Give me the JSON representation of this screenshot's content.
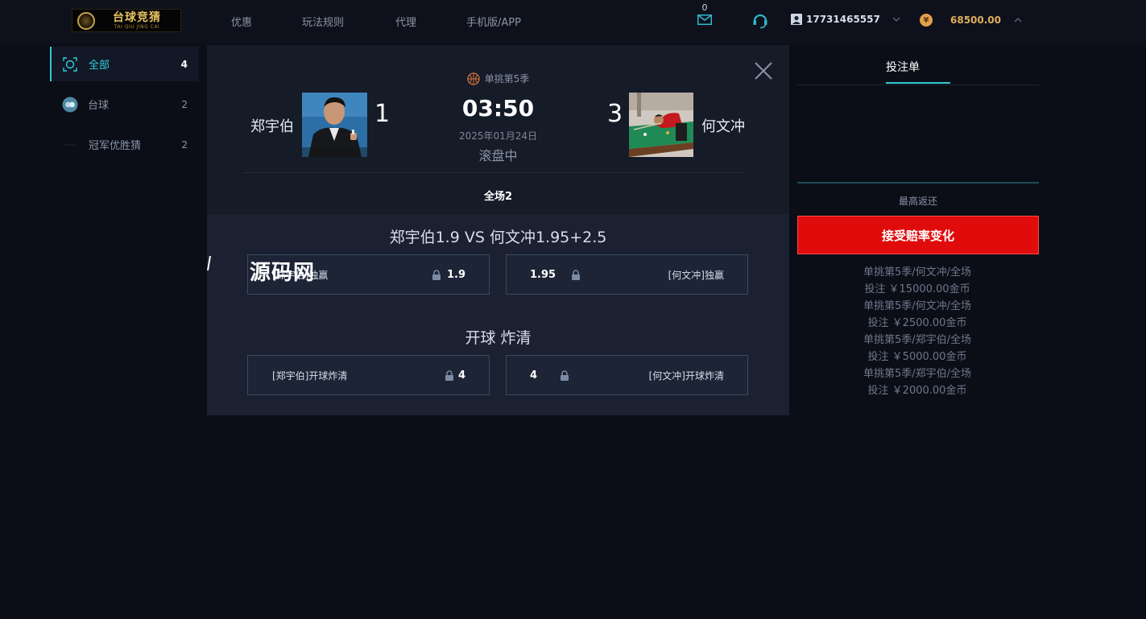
{
  "header": {
    "logo": {
      "title": "台球竞猜",
      "subtitle": "TAI QIU JING CAI"
    },
    "nav": [
      "优惠",
      "玩法规则",
      "代理",
      "手机版/APP"
    ],
    "mail_count": "0",
    "user_phone": "17731465557",
    "balance": "68500.00",
    "coin_symbol": "¥"
  },
  "sidebar": {
    "items": [
      {
        "label": "全部",
        "count": "4",
        "icon": "all-icon",
        "active": true
      },
      {
        "label": "台球",
        "count": "2",
        "icon": "billiards-icon",
        "active": false
      },
      {
        "label": "冠军优胜猜",
        "count": "2",
        "icon": "trophy-icon",
        "active": false
      }
    ]
  },
  "match": {
    "league": "单挑第5季",
    "home": {
      "name": "郑宇伯",
      "score": "1"
    },
    "away": {
      "name": "何文冲",
      "score": "3"
    },
    "clock": "03:50",
    "date": "2025年01月24日",
    "status": "滚盘中",
    "period": "全场2"
  },
  "markets": [
    {
      "title": "郑宇伯1.9 VS 何文冲1.95+2.5",
      "left": {
        "label": "[郑宇伯]独赢",
        "odd": "1.9"
      },
      "right": {
        "label": "[何文冲]独赢",
        "odd": "1.95"
      }
    },
    {
      "title": "开球 炸清",
      "left": {
        "label": "[郑宇伯]开球炸清",
        "odd": "4"
      },
      "right": {
        "label": "[何文冲]开球炸清",
        "odd": "4"
      }
    }
  ],
  "watermark": "源码网",
  "slip": {
    "tab": "投注单",
    "max_return": "最高返还",
    "accept_button": "接受赔率变化",
    "history": [
      "单挑第5季/何文冲/全场",
      "投注 ￥15000.00金币",
      "单挑第5季/何文冲/全场",
      "投注 ￥2500.00金币",
      "单挑第5季/郑宇伯/全场",
      "投注 ￥5000.00金币",
      "单挑第5季/郑宇伯/全场",
      "投注 ￥2000.00金币"
    ]
  },
  "colors": {
    "accent": "#35c8d8",
    "accept": "#e00c0c",
    "balance": "#e1ad5c"
  }
}
